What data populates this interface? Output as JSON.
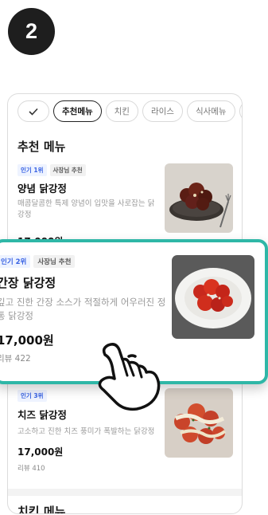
{
  "step": {
    "number": "2"
  },
  "chips": [
    "추천메뉴",
    "치킨",
    "라이스",
    "식사메뉴",
    "식"
  ],
  "sections": {
    "recommended": "추천 메뉴",
    "chicken": "치킨 메뉴"
  },
  "items": [
    {
      "rank": "인기 1위",
      "owner_tag": "사장님 추천",
      "name": "양념 닭강정",
      "desc": "매콤달콤한 특제 양념이 입맛을 사로잡는 닭강정",
      "price": "17,000원"
    },
    {
      "rank": "인기 2위",
      "owner_tag": "사장님 추천",
      "name": "간장 닭강정",
      "desc": "깊고 진한 간장 소스가 적절하게 어우러진 정통 닭강정",
      "price": "17,000원",
      "review": "리뷰 422"
    },
    {
      "rank": "인기 3위",
      "name": "치즈 닭강정",
      "desc": "고소하고 진한 치즈 풍미가 폭발하는 닭강정",
      "price": "17,000원",
      "review": "리뷰 410"
    }
  ],
  "colors": {
    "highlight_border": "#2fb7a7",
    "rank_tag": "#3862e3",
    "badge": "#1e1e1e"
  },
  "icons": {
    "check": "check-icon",
    "pointer": "tap-hand-icon"
  }
}
